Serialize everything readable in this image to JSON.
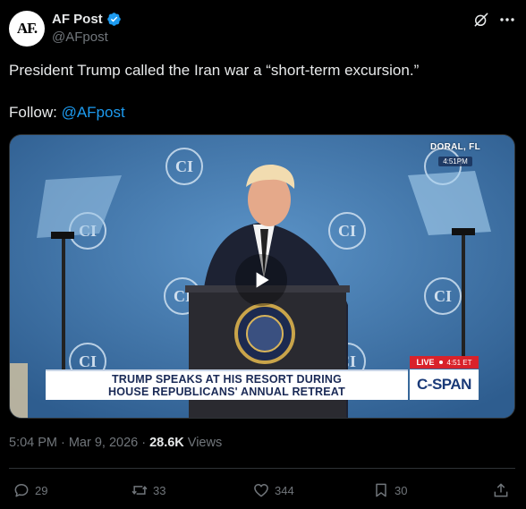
{
  "author": {
    "avatar_text": "AF.",
    "display_name": "AF Post",
    "handle": "@AFpost"
  },
  "header_icons": {
    "grok": "grok-icon",
    "more": "more-icon"
  },
  "post": {
    "text": "President Trump called the Iran war a “short-term excursion.”",
    "follow_label": "Follow: ",
    "follow_link": "@AFpost"
  },
  "media": {
    "location": "DORAL, FL",
    "location_time": "4:51PM",
    "chyron_line1": "TRUMP SPEAKS AT HIS RESORT DURING",
    "chyron_line2": "HOUSE REPUBLICANS' ANNUAL RETREAT",
    "live_label": "LIVE",
    "live_time": "4:51 ET",
    "network": "C-SPAN",
    "backdrop_logo": "CI",
    "play_icon": "play-icon"
  },
  "meta": {
    "time": "5:04 PM",
    "separator": "·",
    "date": "Mar 9, 2026",
    "views_count": "28.6K",
    "views_label": "Views"
  },
  "actions": {
    "replies": "29",
    "reposts": "33",
    "likes": "344",
    "bookmarks": "30"
  },
  "colors": {
    "background": "#000000",
    "text": "#e7e9ea",
    "secondary": "#71767b",
    "link": "#1d9bf0",
    "verified": "#1d9bf0"
  }
}
